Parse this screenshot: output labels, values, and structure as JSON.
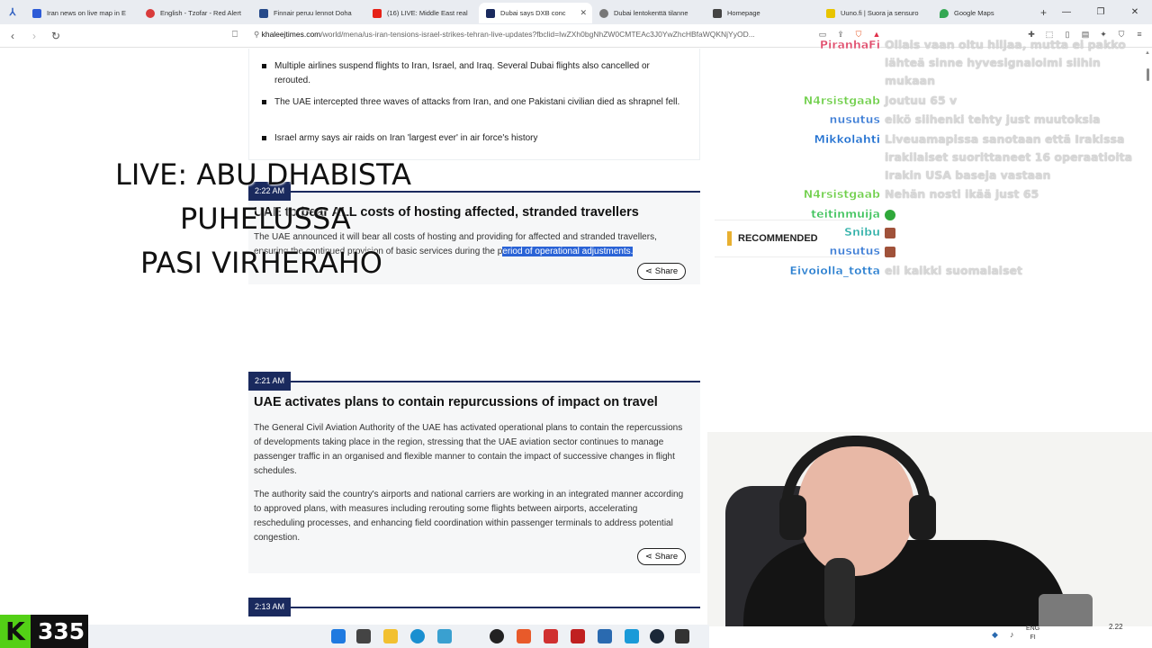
{
  "browser": {
    "tabs": [
      {
        "label": "Iran news on live map in E",
        "color": "#2d5bd7",
        "active": false
      },
      {
        "label": "English - Tzofar - Red Alert",
        "color": "#d93b3b",
        "active": false
      },
      {
        "label": "Finnair peruu lennot Doha",
        "color": "#264a8a",
        "active": false
      },
      {
        "label": "(16) LIVE: Middle East real",
        "color": "#e62117",
        "active": false
      },
      {
        "label": "Dubai says DXB conc",
        "color": "#1a2a5e",
        "active": true
      },
      {
        "label": "Dubai lentokenttä tilanne",
        "color": "#777777",
        "active": false
      },
      {
        "label": "Homepage",
        "color": "#444444",
        "active": false
      },
      {
        "label": "Uuno.fi | Suora ja sensuro",
        "color": "#e8c400",
        "active": false
      },
      {
        "label": "Google Maps",
        "color": "#34a853",
        "active": false
      }
    ],
    "url_host": "khaleejtimes.com",
    "url_rest": "/world/mena/us-iran-tensions-israel-strikes-tehran-live-updates?fbclid=IwZXh0bgNhZW0CMTEAc3J0YwZhcHBfaWQKNjYyOD...",
    "new_tab": "+"
  },
  "summary": {
    "bullets": [
      "Multiple airlines suspend flights to Iran, Israel, and Iraq. Several Dubai flights also cancelled or rerouted.",
      "The UAE intercepted three waves of attacks from Iran, and one Pakistani civilian died as shrapnel fell.",
      "Israel army says air raids on Iran 'largest ever' in air force's history"
    ]
  },
  "posts": [
    {
      "time": "2:22 AM",
      "headline": "UAE to bear ALL costs of hosting affected, stranded travellers",
      "paragraph_plain": "The UAE announced it will bear all costs of hosting and providing for affected and stranded travellers, ensuring the continued provision of basic services during the p",
      "paragraph_selected": "eriod of operational adjustments.",
      "share": "Share"
    },
    {
      "time": "2:21 AM",
      "headline": "UAE activates plans to contain repurcussions of impact on travel",
      "paragraph1": "The General Civil Aviation Authority of the UAE has activated operational plans to contain the repercussions of developments taking place in the region, stressing that the UAE aviation sector continues to manage passenger traffic in an organised and flexible manner to contain the impact of successive changes in flight schedules.",
      "paragraph2": "The authority said the country's airports and national carriers are working in an integrated manner according to approved plans, with measures including rerouting some flights between airports, accelerating rescheduling processes, and enhancing field coordination within passenger terminals to address potential congestion.",
      "share": "Share"
    },
    {
      "time": "2:13 AM"
    }
  ],
  "recommended": "RECOMMENDED",
  "overlay_title": {
    "line1": "LIVE: ABU DHABISTA",
    "line2": "PUHELUSSA",
    "line3": "PASI VIRHERAHO"
  },
  "chat": [
    {
      "user": "PiranhaFi",
      "color": "#e04a6a",
      "text": "Ollais vaan oltu hiljaa, mutta ei pakko lähteä sinne hyvesignaloimi siihin mukaan"
    },
    {
      "user": "N4rsistgaab",
      "color": "#6fcf4a",
      "text": "Joutuu 65 v"
    },
    {
      "user": "nusutus",
      "color": "#3a7bd5",
      "text": "eikö siihenki tehty just muutoksia"
    },
    {
      "user": "Mikkolahti",
      "color": "#1f6fd0",
      "text": "Liveuamapissa sanotaan että Irakissa irakilaiset suorittaneet 16 operaatioita Irakin USA baseja vastaan"
    },
    {
      "user": "N4rsistgaab",
      "color": "#6fcf4a",
      "text": "Nehän nosti ikää just 65"
    },
    {
      "user": "teitinmuija",
      "color": "#3cc25a",
      "text": ""
    },
    {
      "user": "Snibu",
      "color": "#2fb0a8",
      "text": ""
    },
    {
      "user": "nusutus",
      "color": "#3a7bd5",
      "text": ""
    },
    {
      "user": "Eivoiolla_totta",
      "color": "#2a7fd0",
      "text": "eli kaikki suomalaiset"
    }
  ],
  "counter": {
    "k": "K",
    "value": "335"
  },
  "tray": {
    "lang1": "ENG",
    "lang2": "FI",
    "time": "2.22"
  }
}
